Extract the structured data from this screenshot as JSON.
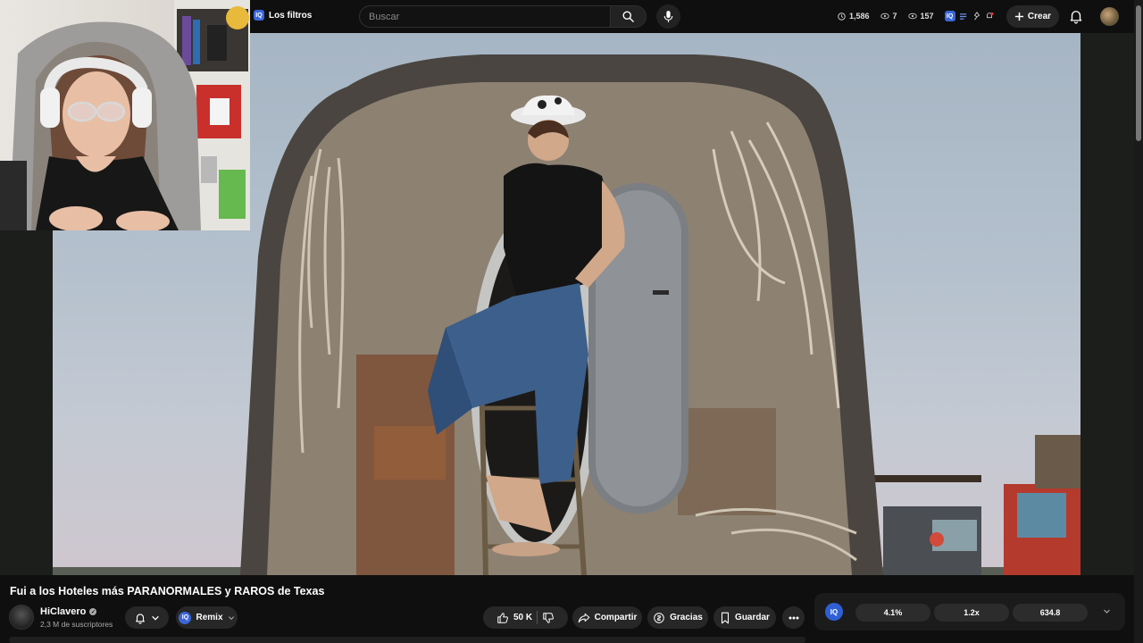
{
  "topbar": {
    "filters_label": "Los filtros",
    "filters_badge": "IQ",
    "search_placeholder": "Buscar",
    "stats": {
      "views": "1,586",
      "eye_small": "7",
      "watching": "157"
    },
    "create_label": "Crear"
  },
  "video": {
    "title": "Fui a los Hoteles más PARANORMALES y RAROS de Texas"
  },
  "channel": {
    "name": "HiClavero",
    "subscribers": "2,3 M de suscriptores"
  },
  "actions": {
    "remix_label": "Remix",
    "remix_badge": "IQ",
    "likes": "50 K",
    "share_label": "Compartir",
    "thanks_label": "Gracias",
    "save_label": "Guardar"
  },
  "panel": {
    "badge": "IQ",
    "metrics": [
      "4.1%",
      "1.2x",
      "634.8"
    ]
  },
  "colors": {
    "background": "#0f0f0f",
    "chip": "#272727",
    "accent_blue": "#3a66d8",
    "sky": "#b5c1cd"
  }
}
